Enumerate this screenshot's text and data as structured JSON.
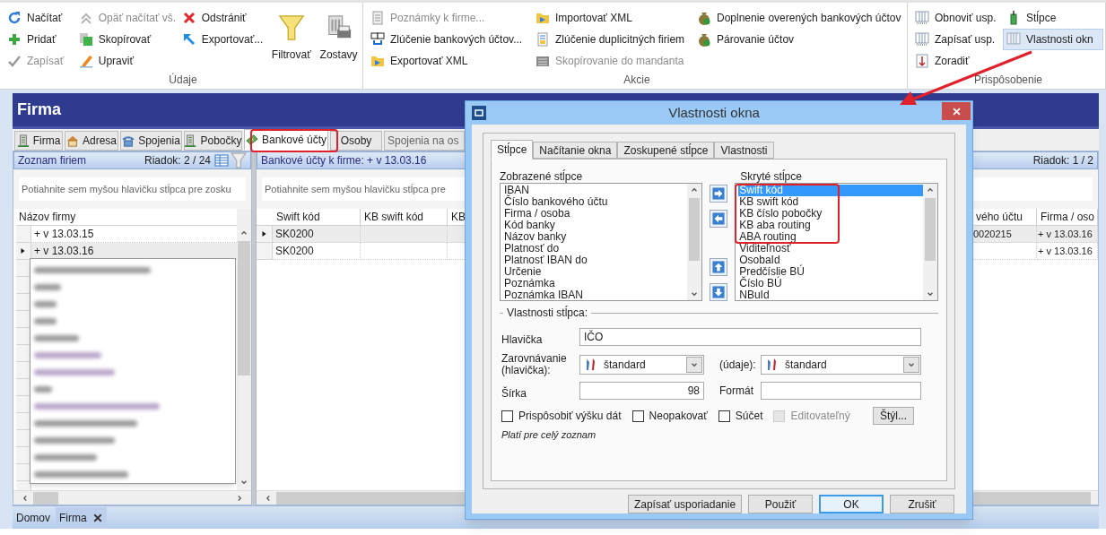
{
  "ribbon": {
    "groups": [
      {
        "label": "Údaje",
        "columns": [
          [
            {
              "label": "Načítať",
              "disabled": false,
              "pressed": false
            },
            {
              "label": "Pridať",
              "disabled": false,
              "pressed": false
            },
            {
              "label": "Zapísať",
              "disabled": true,
              "pressed": false
            }
          ],
          [
            {
              "label": "Opäť načítať vš.",
              "disabled": true,
              "pressed": false
            },
            {
              "label": "Skopírovať",
              "disabled": false,
              "pressed": false
            },
            {
              "label": "Upraviť",
              "disabled": false,
              "pressed": false
            }
          ],
          [
            {
              "label": "Odstrániť",
              "disabled": false,
              "pressed": false
            },
            {
              "label": "Exportovať...",
              "disabled": false,
              "pressed": false
            }
          ]
        ],
        "large_buttons": [
          {
            "label": "Filtrovať"
          },
          {
            "label": "Zostavy"
          }
        ]
      },
      {
        "label": "Akcie",
        "columns": [
          [
            {
              "label": "Poznámky k firme...",
              "disabled": true,
              "pressed": false
            },
            {
              "label": "Zlúčenie bankových účtov...",
              "disabled": false,
              "pressed": false
            },
            {
              "label": "Exportovať XML",
              "disabled": false,
              "pressed": false
            }
          ],
          [
            {
              "label": "Importovať XML",
              "disabled": false,
              "pressed": false
            },
            {
              "label": "Zlúčenie duplicitných firiem",
              "disabled": false,
              "pressed": false
            },
            {
              "label": "Skopírovanie do mandanta",
              "disabled": true,
              "pressed": false
            }
          ],
          [
            {
              "label": "Doplnenie overených bankových účtov",
              "disabled": false,
              "pressed": false
            },
            {
              "label": "Párovanie účtov",
              "disabled": false,
              "pressed": false
            }
          ]
        ]
      },
      {
        "label": "Prispôsobenie",
        "columns": [
          [
            {
              "label": "Obnoviť usp.",
              "disabled": false,
              "pressed": false
            },
            {
              "label": "Zapísať usp.",
              "disabled": false,
              "pressed": false
            },
            {
              "label": "Zoradiť",
              "disabled": false,
              "pressed": false
            }
          ],
          [
            {
              "label": "Stĺpce",
              "disabled": false,
              "pressed": false
            },
            {
              "label": "Vlastnosti okn",
              "disabled": false,
              "pressed": true
            }
          ]
        ]
      }
    ]
  },
  "document": {
    "title": "Firma",
    "tabs": [
      {
        "label": "Firma",
        "selected": false
      },
      {
        "label": "Adresa",
        "selected": false
      },
      {
        "label": "Spojenia",
        "selected": false
      },
      {
        "label": "Pobočky",
        "selected": false
      },
      {
        "label": "Bankové účty",
        "selected": true
      },
      {
        "label": "Osoby",
        "selected": false
      },
      {
        "label": "Spojenia na os",
        "selected": false
      }
    ]
  },
  "company_list": {
    "title": "Zoznam firiem",
    "row_counter": "Riadok: 2 / 24",
    "group_hint": "Potiahnite sem myšou hlavičku stĺpca pre zosku",
    "columns": [
      "Názov firmy"
    ],
    "rows": [
      {
        "cells": [
          "+ v 13.03.15"
        ],
        "selected": false
      },
      {
        "cells": [
          "+ v 13.03.16"
        ],
        "selected": true
      }
    ]
  },
  "accounts": {
    "title": "Bankové účty k firme: + v 13.03.16",
    "row_counter": "Riadok: 1 / 2",
    "group_hint": "Potiahnite sem myšou hlavičku stĺpca pre",
    "columns": [
      "Swift kód",
      "KB swift kód",
      "KB",
      "vého účtu",
      "Firma / oso"
    ],
    "rows": [
      {
        "cells": [
          "SK0200",
          null,
          null,
          "0020215",
          "+ v 13.03.16"
        ],
        "selected": true
      },
      {
        "cells": [
          "SK0200",
          null,
          null,
          null,
          "+ v 13.03.16"
        ],
        "selected": false
      }
    ]
  },
  "dialog": {
    "title": "Vlastnosti okna",
    "tabs": [
      {
        "label": "Stĺpce",
        "selected": true
      },
      {
        "label": "Načítanie okna",
        "selected": false
      },
      {
        "label": "Zoskupené stĺpce",
        "selected": false
      },
      {
        "label": "Vlastnosti",
        "selected": false
      }
    ],
    "shown_label": "Zobrazené stĺpce",
    "shown_columns": [
      "IBAN",
      "Číslo bankového účtu",
      "Firma / osoba",
      "Kód banky",
      "Názov banky",
      "Platnosť do",
      "Platnosť IBAN do",
      "Určenie",
      "Poznámka",
      "Poznámka IBAN"
    ],
    "hidden_label": "Skryté stĺpce",
    "hidden_columns": [
      {
        "label": "Swift kód",
        "selected": true
      },
      {
        "label": "KB swift kód",
        "selected": false
      },
      {
        "label": "KB číslo pobočky",
        "selected": false
      },
      {
        "label": "KB aba routing",
        "selected": false
      },
      {
        "label": "ABA routing",
        "selected": false
      },
      {
        "label": "Viditeľnosť",
        "selected": false
      },
      {
        "label": "OsobaId",
        "selected": false
      },
      {
        "label": "Predčíslie BÚ",
        "selected": false
      },
      {
        "label": "Číslo BÚ",
        "selected": false
      },
      {
        "label": "NBuId",
        "selected": false
      }
    ],
    "section_title": "Vlastnosti stĺpca:",
    "header_label": "Hlavička",
    "header_value": "IČO",
    "align_header_label": "Zarovnávanie (hlavička):",
    "align_header_value": "štandard",
    "align_data_label": "(údaje):",
    "align_data_value": "štandard",
    "width_label": "Šírka",
    "width_value": "98",
    "format_label": "Formát",
    "checkboxes": [
      {
        "label": "Prispôsobiť výšku dát",
        "checked": false,
        "disabled": false
      },
      {
        "label": "Neopakovať",
        "checked": false,
        "disabled": false
      },
      {
        "label": "Súčet",
        "checked": false,
        "disabled": false
      },
      {
        "label": "Editovateľný",
        "checked": false,
        "disabled": true
      }
    ],
    "style_button": "Štýl...",
    "note": "Platí pre celý zoznam",
    "buttons": [
      {
        "label": "Zapísať usporiadanie",
        "default": false
      },
      {
        "label": "Použiť",
        "default": false
      },
      {
        "label": "OK",
        "default": true
      },
      {
        "label": "Zrušiť",
        "default": false
      }
    ]
  },
  "bottom_tabs": [
    {
      "label": "Domov",
      "selected": false,
      "closable": false
    },
    {
      "label": "Firma",
      "selected": true,
      "closable": true
    }
  ]
}
